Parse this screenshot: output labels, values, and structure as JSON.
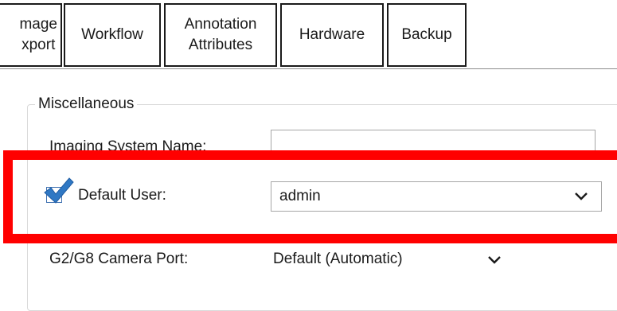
{
  "tabs": [
    {
      "label": "mage\nxport"
    },
    {
      "label": "Workflow"
    },
    {
      "label": "Annotation\nAttributes"
    },
    {
      "label": "Hardware"
    },
    {
      "label": "Backup"
    }
  ],
  "group": {
    "title": "Miscellaneous",
    "imaging_system_name": {
      "label": "Imaging System Name:",
      "value": ""
    },
    "default_user": {
      "label": "Default User:",
      "checked": true,
      "value": "admin"
    },
    "camera_port": {
      "label": "G2/G8 Camera Port:",
      "value": "Default (Automatic)"
    }
  },
  "colors": {
    "highlight": "#ff0000",
    "checkbox": "#2f78c4"
  },
  "icons": [
    "check-icon",
    "chevron-down-icon"
  ]
}
